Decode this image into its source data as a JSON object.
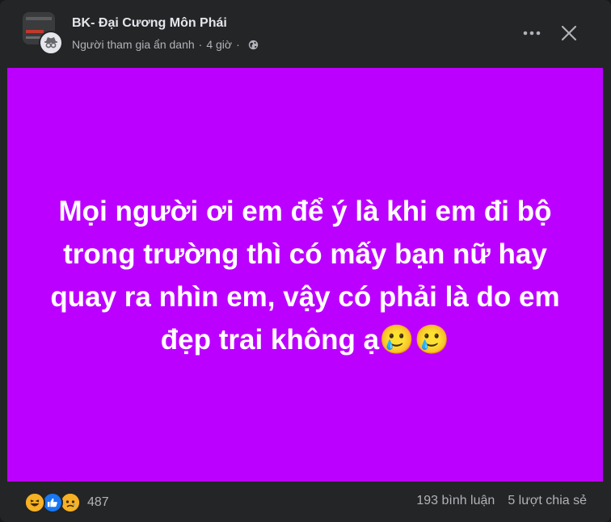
{
  "header": {
    "group_name": "BK- Đại Cương Môn Phái",
    "author": "Người tham gia ẩn danh",
    "separator": "·",
    "time": "4 giờ",
    "privacy_icon": "globe-icon",
    "more_icon": "more-horizontal-icon",
    "close_icon": "close-icon"
  },
  "post": {
    "background_color": "#bc00ff",
    "text": "Mọi người ơi em để ý là khi em đi bộ trong trường thì có mấy bạn nữ hay quay ra nhìn em, vậy có phải là do em đẹp trai không ạ🥲🥲"
  },
  "footer": {
    "reaction_icons": [
      "haha-icon",
      "like-icon",
      "sad-icon"
    ],
    "reaction_count": "487",
    "comments": "193 bình luận",
    "shares": "5 lượt chia sẻ"
  }
}
